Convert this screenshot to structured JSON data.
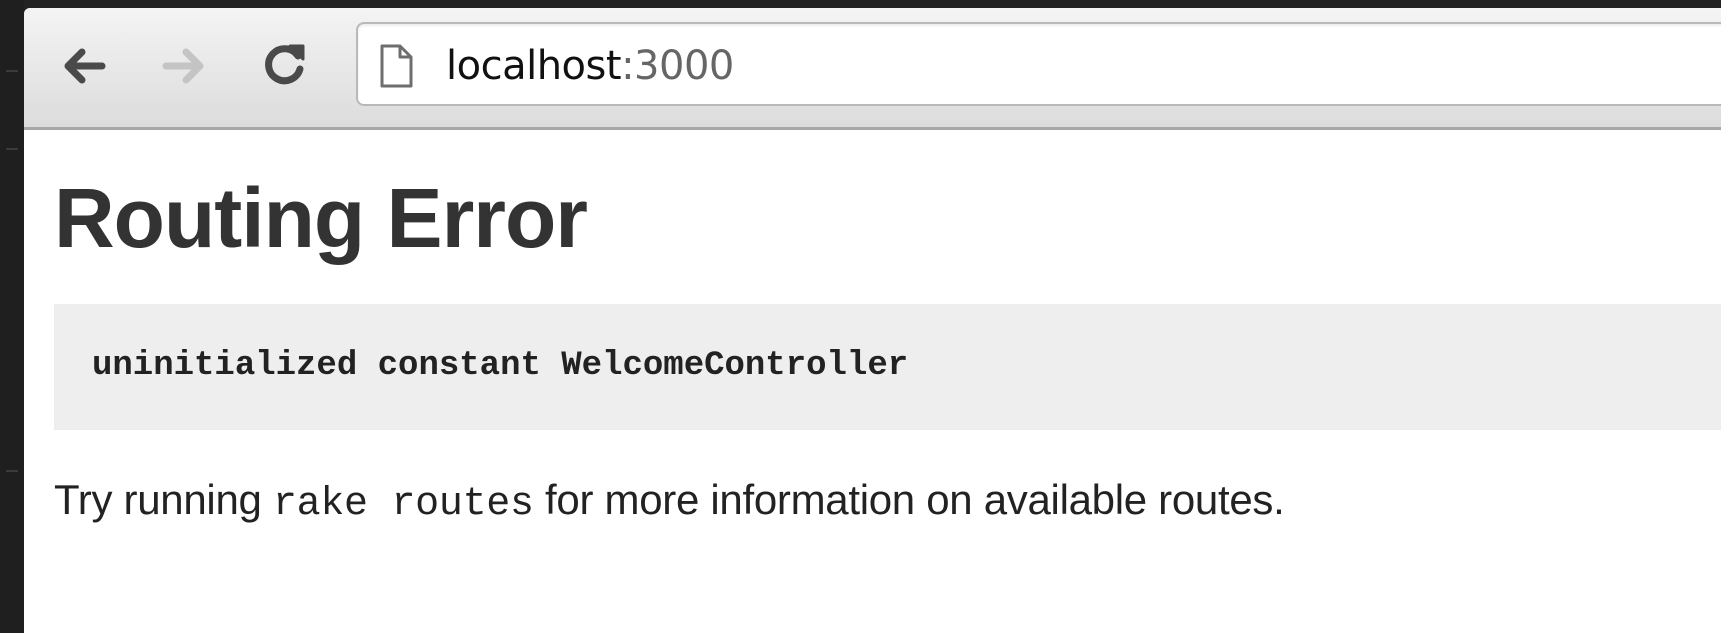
{
  "browser": {
    "url": {
      "host": "localhost",
      "port": ":3000"
    },
    "icons": {
      "back": "arrow-left-icon",
      "forward": "arrow-right-icon",
      "reload": "reload-icon",
      "page": "page-icon"
    }
  },
  "page": {
    "title": "Routing Error",
    "error_message": "uninitialized constant WelcomeController",
    "hint": {
      "before": "Try running ",
      "command": "rake routes",
      "after": " for more information on available routes."
    }
  },
  "colors": {
    "heading": "#333333",
    "error_box_bg": "#eeeeee",
    "forward_disabled": "#c4c4c4",
    "nav_icon": "#4a4a4a"
  }
}
